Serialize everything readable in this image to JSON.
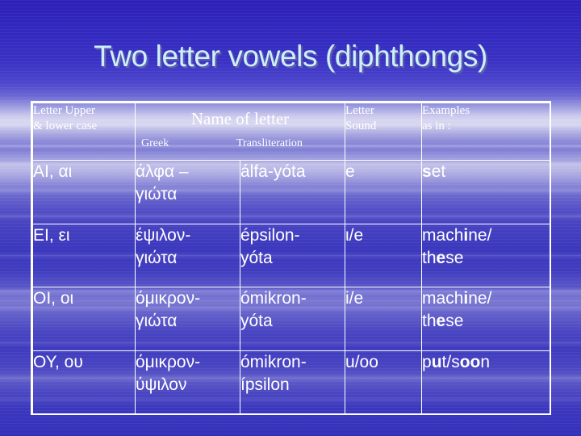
{
  "slide": {
    "title": "Two letter vowels (diphthongs)",
    "background_top_color": "#2d1fb8",
    "background_band_color": "#d9d8f0",
    "title_color": "#cdf1f9",
    "table_border_color": "#ffffff"
  },
  "table": {
    "headers": {
      "col1": {
        "line1": "Letter Upper",
        "line2": "& lower case"
      },
      "col2_3_merged": "Name of letter",
      "col2_sub": "Greek",
      "col3_sub": "Transliteration",
      "col4": {
        "line1": "Letter",
        "line2": "Sound"
      },
      "col5": {
        "line1": "Examples",
        "line2": "as in :"
      }
    },
    "rows": [
      {
        "letters": "ΑΙ, αι",
        "greek_l1": "άλφα –",
        "greek_l2": "γιώτα",
        "translit_l1": "álfa-yóta",
        "translit_l2": "",
        "sound": "e",
        "example_l1_pre": "",
        "example_l1_bold": "s",
        "example_l1_post": "et",
        "example_l2_pre": "",
        "example_l2_bold": "",
        "example_l2_post": ""
      },
      {
        "letters": "ΕΙ, ει",
        "greek_l1": "έψιλον-",
        "greek_l2": "γιώτα",
        "translit_l1": "épsilon-",
        "translit_l2": "yóta",
        "sound": "ι/e",
        "example_l1_pre": "mach",
        "example_l1_bold": "i",
        "example_l1_post": "ne/",
        "example_l2_pre": "th",
        "example_l2_bold": "e",
        "example_l2_post": "se"
      },
      {
        "letters": "ΟΙ, οι",
        "greek_l1": "όμικρον-",
        "greek_l2": "γιώτα",
        "translit_l1": "ómikron-",
        "translit_l2": "yóta",
        "sound": "i/e",
        "example_l1_pre": "mach",
        "example_l1_bold": "i",
        "example_l1_post": "ne/",
        "example_l2_pre": "th",
        "example_l2_bold": "e",
        "example_l2_post": "se"
      },
      {
        "letters": "ΟΥ, ου",
        "greek_l1": "όμικρον-",
        "greek_l2": "ύψιλον",
        "translit_l1": "ómikron-",
        "translit_l2": "ípsilon",
        "sound": "u/oo",
        "example_l1_pre": "p",
        "example_l1_bold": "u",
        "example_l1_post": "t/s",
        "example_l2_pre": "",
        "example_l2_bold": "oo",
        "example_l2_post": "n"
      }
    ]
  }
}
